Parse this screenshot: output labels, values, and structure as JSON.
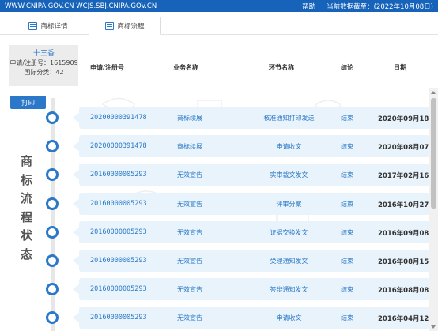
{
  "topbar": {
    "url": "WWW.CNIPA.GOV.CN WCJS.SBJ.CNIPA.GOV.CN",
    "help": "帮助",
    "data_date": "当前数据截至：(2022年10月08日)"
  },
  "tabs": [
    {
      "label": "商标详情",
      "icon": "list-icon"
    },
    {
      "label": "商标流程",
      "icon": "list-icon"
    }
  ],
  "info": {
    "owner": "十三香",
    "reg_no": "申请/注册号：1615909",
    "class": "国际分类：42"
  },
  "table_headers": {
    "reg_no": "申请/注册号",
    "business": "业务名称",
    "step": "环节名称",
    "result": "结论",
    "date": "日期"
  },
  "print_label": "打印",
  "vertical_title": "商标流程状态",
  "rows": [
    {
      "reg": "20200000391478",
      "biz": "商标续展",
      "step": "核准通知打印发送",
      "res": "结束",
      "date": "2020年09月18日"
    },
    {
      "reg": "20200000391478",
      "biz": "商标续展",
      "step": "申请收文",
      "res": "结束",
      "date": "2020年08月07日"
    },
    {
      "reg": "20160000005293",
      "biz": "无效宣告",
      "step": "实审裁文发文",
      "res": "结束",
      "date": "2017年02月16日"
    },
    {
      "reg": "20160000005293",
      "biz": "无效宣告",
      "step": "评审分案",
      "res": "结束",
      "date": "2016年10月27日"
    },
    {
      "reg": "20160000005293",
      "biz": "无效宣告",
      "step": "证据交换发文",
      "res": "结束",
      "date": "2016年09月08日"
    },
    {
      "reg": "20160000005293",
      "biz": "无效宣告",
      "step": "受理通知发文",
      "res": "结束",
      "date": "2016年08月15日"
    },
    {
      "reg": "20160000005293",
      "biz": "无效宣告",
      "step": "答辩通知发文",
      "res": "结束",
      "date": "2016年08月08日"
    },
    {
      "reg": "20160000005293",
      "biz": "无效宣告",
      "step": "申请收文",
      "res": "结束",
      "date": "2016年04月12日"
    }
  ]
}
